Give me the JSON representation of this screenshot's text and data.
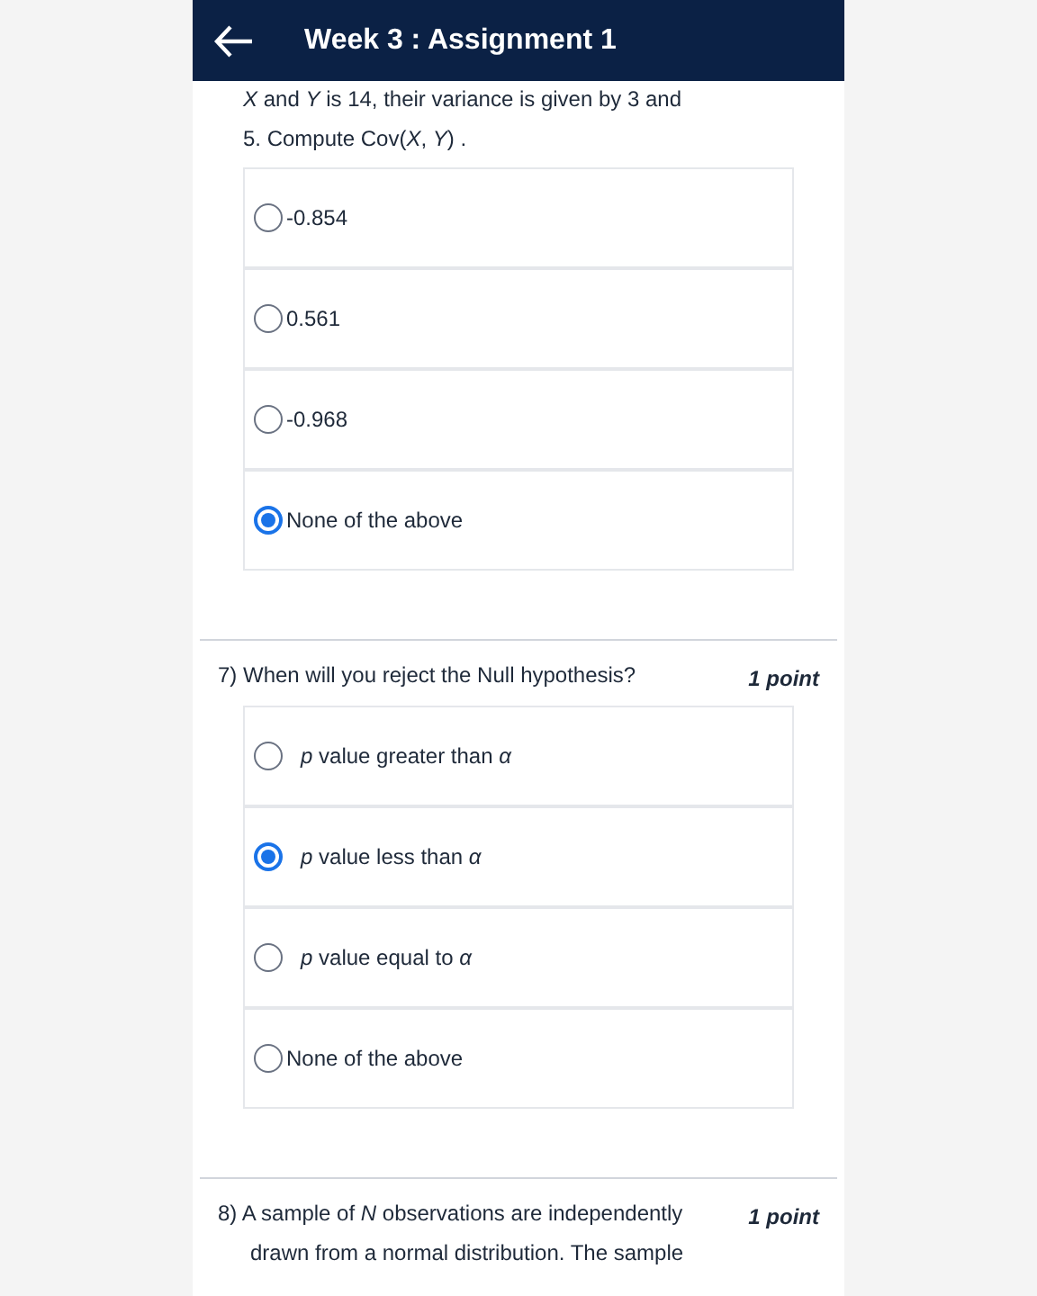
{
  "header": {
    "title": "Week 3 : Assignment 1"
  },
  "question_6": {
    "text_lines": [
      "*X*  and  *Y*  is 14, their variance is given by 3 and",
      "5. Compute  Cov(*X*, *Y*) ."
    ],
    "options": [
      {
        "label": "-0.854",
        "selected": false
      },
      {
        "label": "0.561",
        "selected": false
      },
      {
        "label": "-0.968",
        "selected": false
      },
      {
        "label": "None of the above",
        "selected": true
      }
    ]
  },
  "question_7": {
    "number": "7)",
    "text": "When will you reject the Null hypothesis?",
    "points": "1 point",
    "options": [
      {
        "label": "*p*  value greater than  *α*",
        "selected": false
      },
      {
        "label": "*p*  value less than  *α*",
        "selected": true
      },
      {
        "label": "*p*  value equal to  *α*",
        "selected": false
      },
      {
        "label": "None of the above",
        "selected": false
      }
    ]
  },
  "question_8": {
    "number": "8)",
    "text": "A sample of  *N*  observations are independently",
    "points": "1 point",
    "text_continued": "drawn from a normal distribution. The sample"
  }
}
